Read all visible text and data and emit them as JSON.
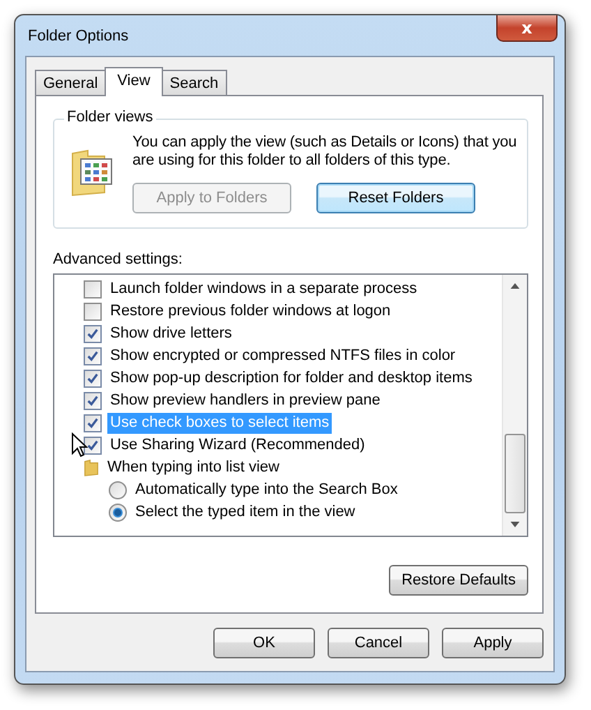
{
  "window": {
    "title": "Folder Options",
    "close": "x"
  },
  "tabs": [
    {
      "label": "General",
      "selected": false
    },
    {
      "label": "View",
      "selected": true
    },
    {
      "label": "Search",
      "selected": false
    }
  ],
  "folder_views": {
    "title": "Folder views",
    "text": "You can apply the view (such as Details or Icons) that you are using for this folder to all folders of this type.",
    "buttons": [
      {
        "label": "Apply to Folders",
        "disabled": true
      },
      {
        "label": "Reset Folders",
        "disabled": false
      }
    ]
  },
  "advanced": {
    "label": "Advanced settings:",
    "items": [
      {
        "kind": "checkbox",
        "label": "Launch folder windows in a separate process",
        "checked": false,
        "selected": false
      },
      {
        "kind": "checkbox",
        "label": "Restore previous folder windows at logon",
        "checked": false,
        "selected": false
      },
      {
        "kind": "checkbox",
        "label": "Show drive letters",
        "checked": true,
        "selected": false
      },
      {
        "kind": "checkbox",
        "label": "Show encrypted or compressed NTFS files in color",
        "checked": true,
        "selected": false
      },
      {
        "kind": "checkbox",
        "label": "Show pop-up description for folder and desktop items",
        "checked": true,
        "selected": false
      },
      {
        "kind": "checkbox",
        "label": "Show preview handlers in preview pane",
        "checked": true,
        "selected": false
      },
      {
        "kind": "checkbox",
        "label": "Use check boxes to select items",
        "checked": true,
        "selected": true
      },
      {
        "kind": "checkbox",
        "label": "Use Sharing Wizard (Recommended)",
        "checked": true,
        "selected": false
      },
      {
        "kind": "folder",
        "label": "When typing into list view",
        "selected": false,
        "children": [
          {
            "kind": "radio",
            "label": "Automatically type into the Search Box",
            "checked": false,
            "selected": false
          },
          {
            "kind": "radio",
            "label": "Select the typed item in the view",
            "checked": true,
            "selected": false
          }
        ]
      }
    ]
  },
  "restore_button": "Restore Defaults",
  "buttons": [
    "OK",
    "Cancel",
    "Apply"
  ]
}
